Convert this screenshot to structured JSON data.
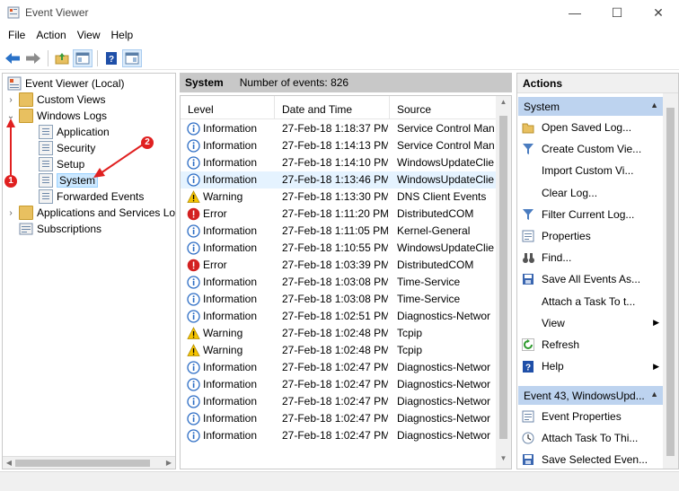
{
  "window": {
    "title": "Event Viewer",
    "controls": {
      "minimize": "—",
      "maximize": "☐",
      "close": "✕"
    }
  },
  "menu": [
    "File",
    "Action",
    "View",
    "Help"
  ],
  "toolbar": {
    "icons": [
      "back-arrow-icon",
      "forward-arrow-icon",
      "up-folder-icon",
      "show-hide-tree-icon",
      "help-icon",
      "show-hide-action-pane-icon"
    ]
  },
  "tree": {
    "items": [
      {
        "label": "Event Viewer (Local)",
        "icon": "event-viewer-icon",
        "expander": ""
      },
      {
        "label": "Custom Views",
        "icon": "folder-icon",
        "expander": "›"
      },
      {
        "label": "Windows Logs",
        "icon": "folder-icon",
        "expander": "⌄"
      },
      {
        "label": "Application",
        "icon": "log-icon",
        "expander": ""
      },
      {
        "label": "Security",
        "icon": "log-icon",
        "expander": ""
      },
      {
        "label": "Setup",
        "icon": "log-icon",
        "expander": ""
      },
      {
        "label": "System",
        "icon": "log-icon",
        "expander": ""
      },
      {
        "label": "Forwarded Events",
        "icon": "log-icon",
        "expander": ""
      },
      {
        "label": "Applications and Services Lo",
        "icon": "folder-icon",
        "expander": "›"
      },
      {
        "label": "Subscriptions",
        "icon": "subscriptions-icon",
        "expander": ""
      }
    ],
    "selected": "System"
  },
  "middle": {
    "log_name": "System",
    "event_count": "Number of events: 826",
    "columns": [
      "Level",
      "Date and Time",
      "Source"
    ],
    "rows": [
      {
        "level": "Information",
        "date": "27-Feb-18 1:18:37 PM",
        "source": "Service Control Man"
      },
      {
        "level": "Information",
        "date": "27-Feb-18 1:14:13 PM",
        "source": "Service Control Man"
      },
      {
        "level": "Information",
        "date": "27-Feb-18 1:14:10 PM",
        "source": "WindowsUpdateClie"
      },
      {
        "level": "Information",
        "date": "27-Feb-18 1:13:46 PM",
        "source": "WindowsUpdateClie"
      },
      {
        "level": "Warning",
        "date": "27-Feb-18 1:13:30 PM",
        "source": "DNS Client Events"
      },
      {
        "level": "Error",
        "date": "27-Feb-18 1:11:20 PM",
        "source": "DistributedCOM"
      },
      {
        "level": "Information",
        "date": "27-Feb-18 1:11:05 PM",
        "source": "Kernel-General"
      },
      {
        "level": "Information",
        "date": "27-Feb-18 1:10:55 PM",
        "source": "WindowsUpdateClie"
      },
      {
        "level": "Error",
        "date": "27-Feb-18 1:03:39 PM",
        "source": "DistributedCOM"
      },
      {
        "level": "Information",
        "date": "27-Feb-18 1:03:08 PM",
        "source": "Time-Service"
      },
      {
        "level": "Information",
        "date": "27-Feb-18 1:03:08 PM",
        "source": "Time-Service"
      },
      {
        "level": "Information",
        "date": "27-Feb-18 1:02:51 PM",
        "source": "Diagnostics-Networ"
      },
      {
        "level": "Warning",
        "date": "27-Feb-18 1:02:48 PM",
        "source": "Tcpip"
      },
      {
        "level": "Warning",
        "date": "27-Feb-18 1:02:48 PM",
        "source": "Tcpip"
      },
      {
        "level": "Information",
        "date": "27-Feb-18 1:02:47 PM",
        "source": "Diagnostics-Networ"
      },
      {
        "level": "Information",
        "date": "27-Feb-18 1:02:47 PM",
        "source": "Diagnostics-Networ"
      },
      {
        "level": "Information",
        "date": "27-Feb-18 1:02:47 PM",
        "source": "Diagnostics-Networ"
      },
      {
        "level": "Information",
        "date": "27-Feb-18 1:02:47 PM",
        "source": "Diagnostics-Networ"
      },
      {
        "level": "Information",
        "date": "27-Feb-18 1:02:47 PM",
        "source": "Diagnostics-Networ"
      }
    ],
    "selected_row": 3
  },
  "actions": {
    "title": "Actions",
    "section1": "System",
    "section1_items": [
      {
        "label": "Open Saved Log...",
        "icon": "open-folder-icon"
      },
      {
        "label": "Create Custom Vie...",
        "icon": "filter-icon"
      },
      {
        "label": "Import Custom Vi...",
        "icon": ""
      },
      {
        "label": "Clear Log...",
        "icon": ""
      },
      {
        "label": "Filter Current Log...",
        "icon": "filter-icon"
      },
      {
        "label": "Properties",
        "icon": "properties-icon"
      },
      {
        "label": "Find...",
        "icon": "binoculars-icon"
      },
      {
        "label": "Save All Events As...",
        "icon": "save-icon"
      },
      {
        "label": "Attach a Task To t...",
        "icon": ""
      },
      {
        "label": "View",
        "icon": "",
        "submenu": true
      },
      {
        "label": "Refresh",
        "icon": "refresh-icon"
      },
      {
        "label": "Help",
        "icon": "help-icon",
        "submenu": true
      }
    ],
    "section2": "Event 43, WindowsUpd...",
    "section2_items": [
      {
        "label": "Event Properties",
        "icon": "properties-icon"
      },
      {
        "label": "Attach Task To Thi...",
        "icon": "attach-task-icon"
      },
      {
        "label": "Save Selected Even...",
        "icon": "save-icon"
      }
    ]
  },
  "annotations": {
    "badge1": "1",
    "badge2": "2"
  },
  "colors": {
    "accent_section": "#bdd3ef",
    "selection": "#cce8ff",
    "annotation_red": "#e02020",
    "info_blue": "#2b6cc4",
    "warning_yellow": "#f5c400",
    "error_red": "#d32020"
  }
}
